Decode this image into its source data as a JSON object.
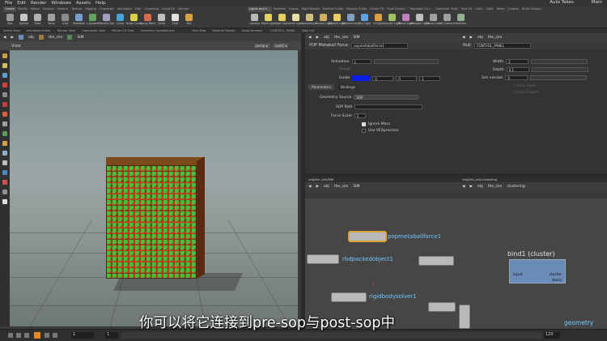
{
  "menu": [
    "File",
    "Edit",
    "Render",
    "Windows",
    "Assets",
    "Help"
  ],
  "menu_right": {
    "auto_takes": "Auto Takes",
    "take": "Main"
  },
  "shelf_tabs_left": [
    "Create",
    "Modify",
    "Model",
    "Polygon",
    "Deform",
    "Texture",
    "Rigging",
    "Character",
    "Animation",
    "Hair",
    "Grooming",
    "Cloud FX",
    "Volume"
  ],
  "shelf_tabs_right": [
    "Lights and C...",
    "Particles",
    "Grains",
    "Rigid Bodies",
    "Particle Fluids",
    "Viscous Fluids",
    "Ocean FX",
    "Fluid Contai...",
    "Populate Con...",
    "Container Tools",
    "Pyro FX",
    "Cloth",
    "Solid",
    "Wires",
    "Crowds",
    "Drive Simula..."
  ],
  "tools_left": [
    {
      "label": "Box",
      "color": "#9a9a9a"
    },
    {
      "label": "Sphere",
      "color": "#c8c8c8"
    },
    {
      "label": "Tube",
      "color": "#b0b0b0"
    },
    {
      "label": "Torus",
      "color": "#a0a0a0"
    },
    {
      "label": "Grid",
      "color": "#8a8a8a"
    },
    {
      "label": "Metaball",
      "color": "#7a9fcf"
    },
    {
      "label": "L-System",
      "color": "#5fa35f"
    },
    {
      "label": "Platonic Sol.",
      "color": "#9fa0c0"
    },
    {
      "label": "Curve",
      "color": "#4aa3d8"
    },
    {
      "label": "Draw Curve",
      "color": "#d8d04a"
    },
    {
      "label": "Spray Paint",
      "color": "#d86a4a"
    },
    {
      "label": "Circle",
      "color": "#c0c0c0"
    },
    {
      "label": "Font",
      "color": "#e0e0e0"
    },
    {
      "label": "File",
      "color": "#d8a040"
    }
  ],
  "tools_right": [
    {
      "label": "Camera",
      "color": "#b8b8b8"
    },
    {
      "label": "Point Light",
      "color": "#e8d060"
    },
    {
      "label": "Spot Light",
      "color": "#e8d060"
    },
    {
      "label": "Area Light",
      "color": "#e8e0a0"
    },
    {
      "label": "Geometry L.",
      "color": "#d0c080"
    },
    {
      "label": "Volume Light",
      "color": "#d0b060"
    },
    {
      "label": "Distant Light",
      "color": "#e8d060"
    },
    {
      "label": "Environment",
      "color": "#80a0c0"
    },
    {
      "label": "Sky Light",
      "color": "#60a0e0"
    },
    {
      "label": "GI Light",
      "color": "#e0a040"
    },
    {
      "label": "Caustic Light",
      "color": "#a0c060"
    },
    {
      "label": "Portal Light",
      "color": "#c080c0"
    },
    {
      "label": "Ambient Light",
      "color": "#c0c0c0"
    },
    {
      "label": "Stereo Cam",
      "color": "#a0a0a0"
    },
    {
      "label": "VR Camera",
      "color": "#a0a0a0"
    },
    {
      "label": "Switcher",
      "color": "#90b090"
    }
  ],
  "pane_tabs": [
    "Scene View",
    "Animation Editor",
    "Render View",
    "Composite View",
    "Motion FX View",
    "Geometry Spreadsheet",
    "Tree View",
    "Material Palette",
    "Asset Browser",
    "CONTROL_PANEL",
    "Take List"
  ],
  "viewport": {
    "path": [
      "obj",
      "the_sim",
      "SIM"
    ],
    "title": "View",
    "camera_label": "persp ▾",
    "display_label": "cam1 ▾"
  },
  "param": {
    "path": [
      "obj",
      "the_sim",
      "SIM"
    ],
    "node_type": "POP Metaball Force",
    "node_name": "popmetaballforce1",
    "activation_label": "Activation",
    "activation_value": "1",
    "group_label": "Group",
    "guide_label": "Guide",
    "guide_values": [
      "0",
      "0",
      "1"
    ],
    "subtabs": [
      "Parameters",
      "Bindings"
    ],
    "geometry_source_label": "Geometry Source",
    "geometry_source_value": "SOP",
    "sop_path_label": "SOP Path",
    "force_scale_label": "Force Scale",
    "force_scale_value": "1",
    "ignore_mass_label": "Ignore Mass",
    "use_vexpression_label": "Use VEXpression"
  },
  "control": {
    "path": [
      "obj",
      "the_sim"
    ],
    "node_type": "Null",
    "node_name": "CONTROL_PANEL",
    "width_label": "Width",
    "width_value": "2",
    "depth_label": "Depth",
    "depth_value": "0.1",
    "sim_version_label": "Sim version",
    "sim_version_value": "0",
    "cache_input_label": "Cache input",
    "cache_export_label": "Cache Export"
  },
  "net1": {
    "tab": "/obj/the_sim/SIM",
    "path": [
      "obj",
      "the_sim",
      "SIM"
    ],
    "nodes": [
      "popmetaballforce1",
      "rbdpackedobject1",
      "rigidbodysolver1"
    ]
  },
  "net2": {
    "tab": "/obj/the_sim/clustering",
    "path": [
      "obj",
      "the_sim",
      "clustering"
    ],
    "block_title": "bind1 (cluster)",
    "block_input": "input",
    "block_out0": "cluster",
    "block_out1": "basis",
    "geometry_label": "geometry"
  },
  "timeline": {
    "frame": "1",
    "start": "1",
    "end": "120"
  },
  "subtitle": "你可以将它连接到pre-sop与post-sop中"
}
